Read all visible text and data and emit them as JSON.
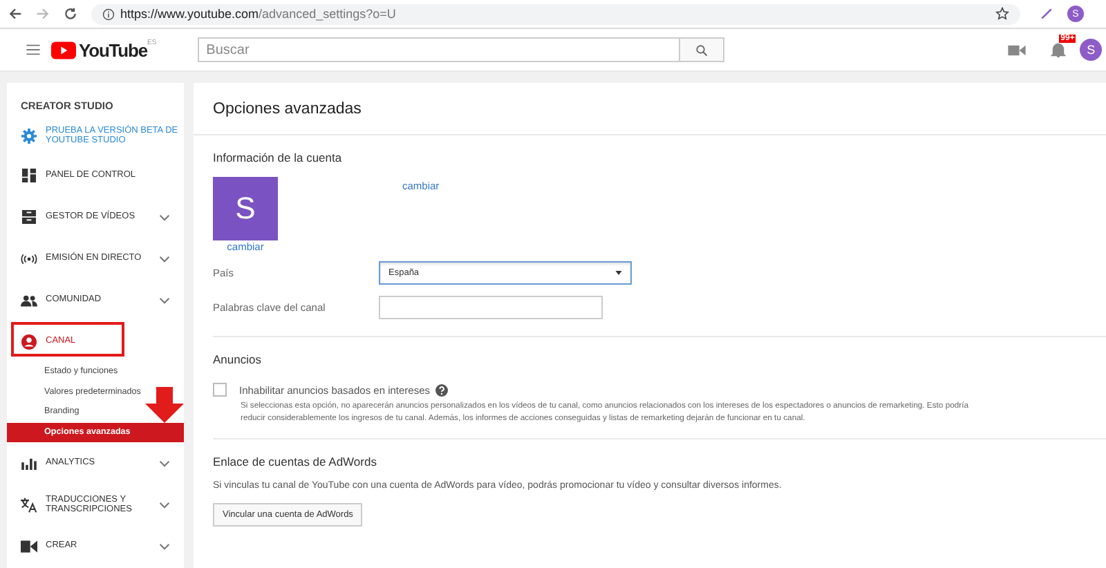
{
  "browser": {
    "url_host": "https://www.youtube.com",
    "url_path": "/advanced_settings?o=U",
    "avatar": "S"
  },
  "header": {
    "logo": "YouTube",
    "logo_region": "ES",
    "search": {
      "placeholder": "Buscar"
    },
    "notification_badge": "99+",
    "avatar": "S"
  },
  "sidebar": {
    "title": "CREATOR STUDIO",
    "items": [
      {
        "label": "PRUEBA LA VERSIÓN BETA DE YOUTUBE STUDIO",
        "kind": "beta",
        "expandable": false,
        "selected": false
      },
      {
        "label": "PANEL DE CONTROL",
        "kind": "nav",
        "expandable": false,
        "selected": false
      },
      {
        "label": "GESTOR DE VÍDEOS",
        "kind": "nav",
        "expandable": true,
        "selected": false
      },
      {
        "label": "EMISIÓN EN DIRECTO",
        "kind": "nav",
        "expandable": true,
        "selected": false
      },
      {
        "label": "COMUNIDAD",
        "kind": "nav",
        "expandable": true,
        "selected": false
      },
      {
        "label": "CANAL",
        "kind": "nav",
        "expandable": false,
        "selected": true,
        "children": [
          {
            "label": "Estado y funciones",
            "selected": false
          },
          {
            "label": "Valores predeterminados",
            "selected": false
          },
          {
            "label": "Branding",
            "selected": false
          },
          {
            "label": "Opciones avanzadas",
            "selected": true
          }
        ]
      },
      {
        "label": "ANALYTICS",
        "kind": "nav",
        "expandable": true,
        "selected": false
      },
      {
        "label": "TRADUCCIONES Y TRANSCRIPCIONES",
        "kind": "nav",
        "expandable": true,
        "selected": false
      },
      {
        "label": "CREAR",
        "kind": "nav",
        "expandable": true,
        "selected": false
      }
    ]
  },
  "annotations": {
    "highlight_box": true,
    "arrow": true
  },
  "page": {
    "title": "Opciones avanzadas",
    "account": {
      "heading": "Información de la cuenta",
      "avatar": "S",
      "change_link": "cambiar",
      "avatar_change_link": "cambiar",
      "country": {
        "label": "País",
        "value": "España"
      },
      "keywords": {
        "label": "Palabras clave del canal"
      }
    },
    "ads": {
      "heading": "Anuncios",
      "checkbox": {
        "label": "Inhabilitar anuncios basados en intereses",
        "checked": false
      },
      "description": "Si seleccionas esta opción, no aparecerán anuncios personalizados en los vídeos de tu canal, como anuncios relacionados con los intereses de los espectadores o anuncios de remarketing. Esto podría reducir considerablemente los ingresos de tu canal. Además, los informes de acciones conseguidas y listas de remarketing dejarán de funcionar en tu canal."
    },
    "adwords": {
      "heading": "Enlace de cuentas de AdWords",
      "text": "Si vinculas tu canal de YouTube con una cuenta de AdWords para vídeo, podrás promocionar tu vídeo y consultar diversos informes.",
      "button": "Vincular una cuenta de AdWords"
    }
  }
}
